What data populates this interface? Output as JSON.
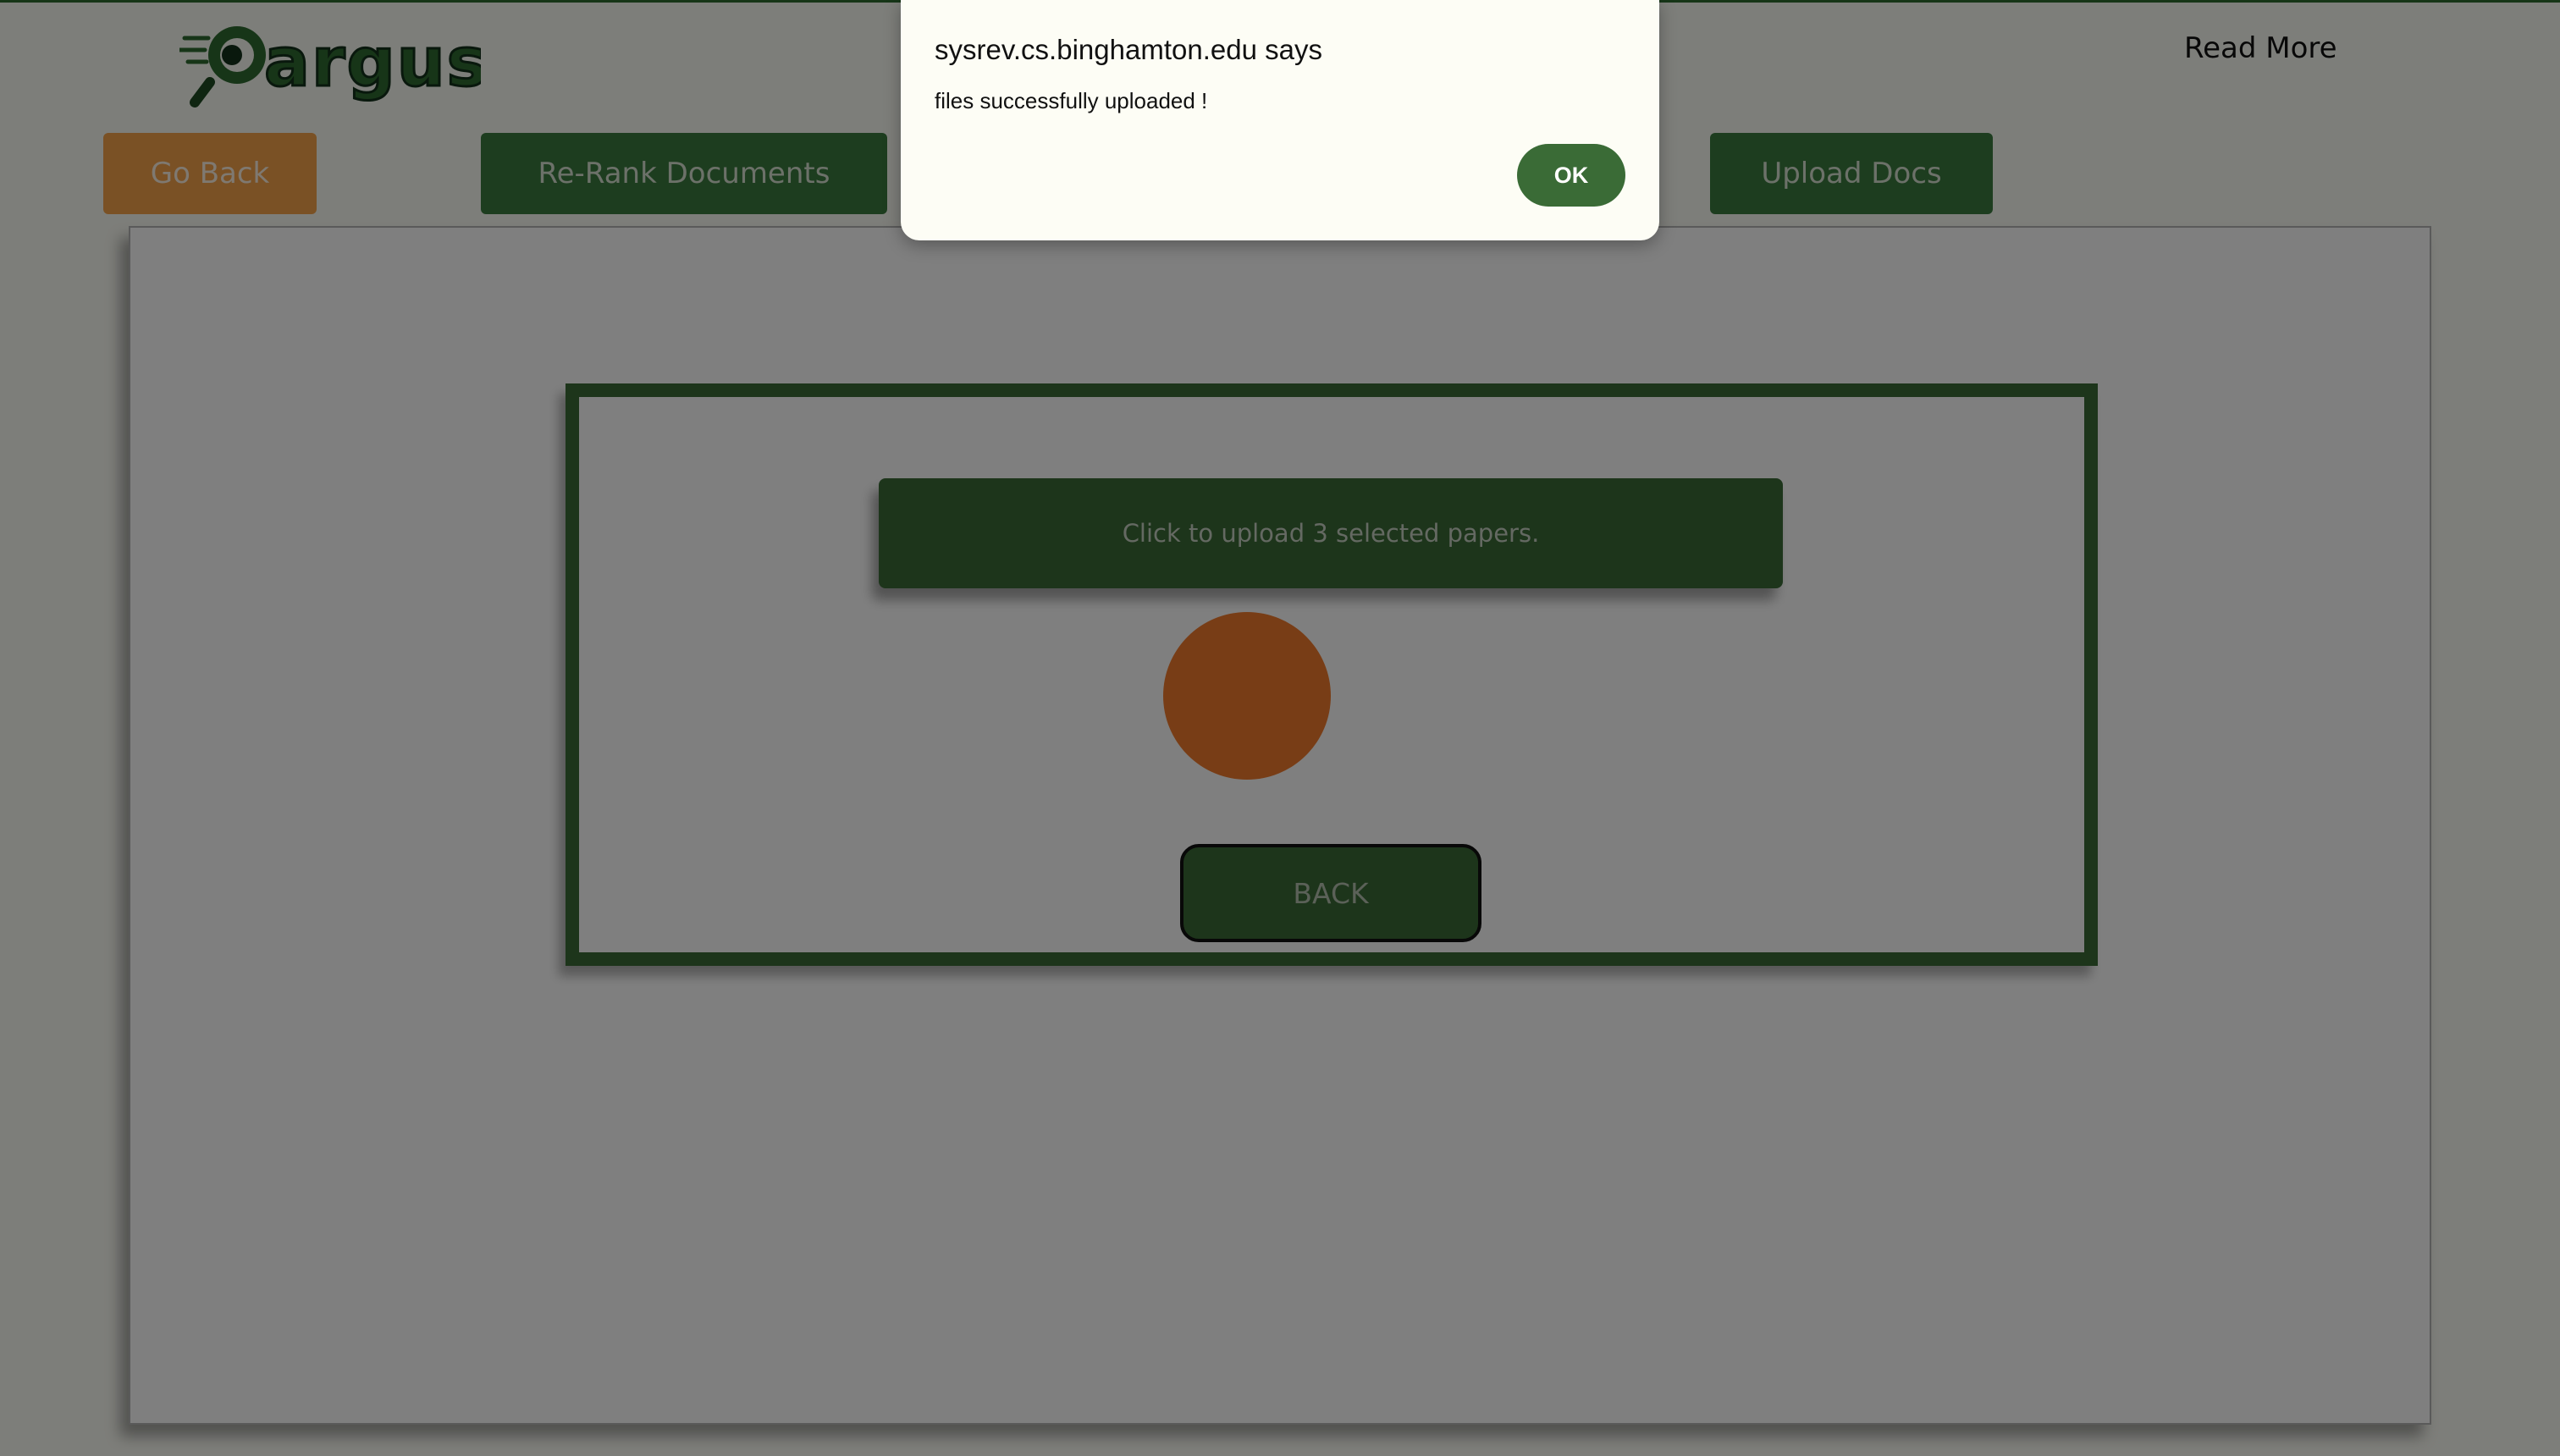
{
  "header": {
    "logo_text": "argus",
    "read_more_label": "Read More"
  },
  "nav": {
    "go_back_label": "Go Back",
    "rerank_label": "Re-Rank Documents",
    "upload_docs_label": "Upload Docs"
  },
  "upload": {
    "upload_bar_label": "Click to upload 3 selected papers.",
    "back_label": "BACK"
  },
  "alert": {
    "title": "sysrev.cs.binghamton.edu says",
    "message": "files successfully uploaded !",
    "ok_label": "OK"
  },
  "colors": {
    "brand_green": "#3a6b36",
    "go_back_orange": "#f4a24a",
    "spinner_orange": "#f07a2c",
    "alert_background": "#fdfdf5"
  },
  "icons": {
    "logo": "argus-logo-magnifier",
    "spinner": "loading-circle"
  }
}
